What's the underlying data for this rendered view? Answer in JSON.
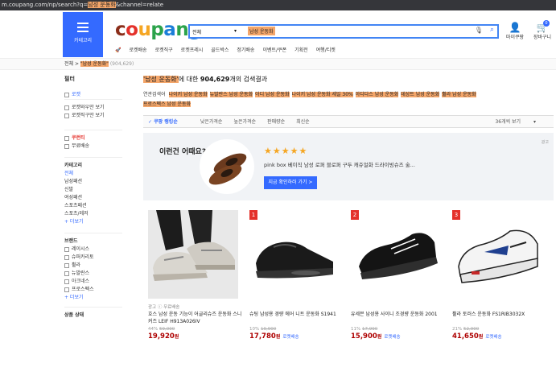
{
  "url_bar": {
    "prefix": "m.coupang.com/np/search?q=",
    "query": "남성 운동화",
    "suffix": "&channel=relate"
  },
  "header": {
    "category_label": "카테고리",
    "logo": "coupang",
    "search": {
      "scope": "전체",
      "query": "남성 운동화"
    },
    "my_coupang": "마이쿠팡",
    "cart": "장바구니",
    "cart_count": "0",
    "nav": [
      "로켓배송",
      "로켓직구",
      "로켓프레시",
      "골드박스",
      "정기배송",
      "이벤트/쿠폰",
      "기획전",
      "여행/티켓"
    ]
  },
  "breadcrumb": {
    "root": "전체",
    "query": "\"남성 운동화\"",
    "count": "(904,629)"
  },
  "sidebar": {
    "filter_title": "필터",
    "rocket_label": "로켓",
    "only_rocket": [
      "로켓와우만 보기",
      "로켓직구만 보기"
    ],
    "coupon_label": "쿠런티",
    "free_ship": "무료배송",
    "category_title": "카테고리",
    "categories": [
      "전체",
      "남성패션",
      "신발",
      "여성패션",
      "스포츠패션",
      "스포츠/레저"
    ],
    "more": "+ 더보기",
    "brand_title": "브랜드",
    "brands": [
      "레이시스",
      "슈퍼카리토",
      "휠라",
      "뉴발란스",
      "아크네스",
      "프로스펙스"
    ],
    "brand_more": "+ 더보기",
    "condition_title": "상품 상태"
  },
  "results": {
    "query": "'남성 운동화'",
    "mid": "에 대한 ",
    "count": "904,629",
    "tail": "개의 검색결과"
  },
  "related": {
    "label": "연관검색어",
    "terms": [
      "나이키 남성 운동화",
      "뉴발란스 남성 운동화",
      "아디 남성 운동화",
      "나이키 남성 운동화 세일 30%",
      "아디다스 남성 운동화",
      "데상트 남성 운동화",
      "휠라 남성 운동화",
      "프로스펙스 남성 운동화"
    ]
  },
  "sort": {
    "items": [
      "쿠팡 랭킹순",
      "낮은가격순",
      "높은가격순",
      "판매량순",
      "최신순"
    ],
    "per_page": "36개씩 보기"
  },
  "banner": {
    "ad": "광고",
    "title": "이런건 어때요?",
    "rating": 4.5,
    "stars": "★★★★★",
    "description": "pink box 베이직 남성 로퍼 블로퍼 구두 캐쥬얼화 드라이빙슈즈 술...",
    "cta": "지금 확인하러 가기 >"
  },
  "products": [
    {
      "rank": "",
      "meta": "광고 ⓘ  무료배송",
      "name": "호스 남성 운동 기능이 어글리슈즈 운동화 스니커즈 LEIF H913A026IV",
      "disc_pct": "44%",
      "orig": "59,000",
      "price": "19,920",
      "rocket": ""
    },
    {
      "rank": "1",
      "meta": "",
      "name": "슈팅 남성용 경량 에어 니트 운동화 S1941",
      "disc_pct": "10%",
      "orig": "19,900",
      "price": "17,780",
      "rocket": "로켓배송"
    },
    {
      "rank": "2",
      "meta": "",
      "name": "유세븐 남성용 사이니 조경량 운동화 2001",
      "disc_pct": "11%",
      "orig": "17,990",
      "price": "15,900",
      "rocket": "로켓배송"
    },
    {
      "rank": "3",
      "meta": "",
      "name": "휠라 토러스 운동화 FS1RIB3032X",
      "disc_pct": "21%",
      "orig": "52,900",
      "price": "41,650",
      "rocket": "로켓배송"
    }
  ],
  "currency": "원"
}
